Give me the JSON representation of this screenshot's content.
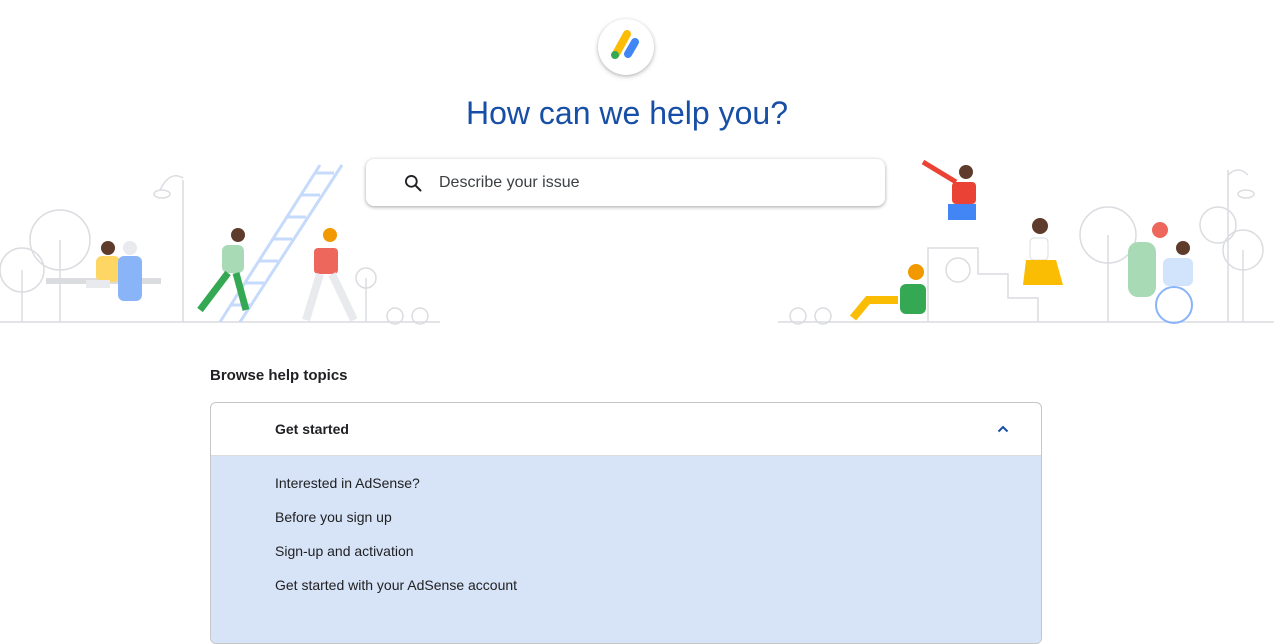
{
  "title": "How can we help you?",
  "search": {
    "placeholder": "Describe your issue"
  },
  "browse": {
    "heading": "Browse help topics",
    "section": {
      "label": "Get started",
      "items": [
        "Interested in AdSense?",
        "Before you sign up",
        "Sign-up and activation",
        "Get started with your AdSense account"
      ]
    }
  },
  "colors": {
    "title": "#174ea6",
    "accordion_body": "#d7e3f6",
    "logo_yellow": "#fbbc04",
    "logo_blue": "#4285f4",
    "logo_green": "#34a853"
  },
  "icons": [
    "adsense-logo-icon",
    "search-icon",
    "chevron-up-icon"
  ]
}
